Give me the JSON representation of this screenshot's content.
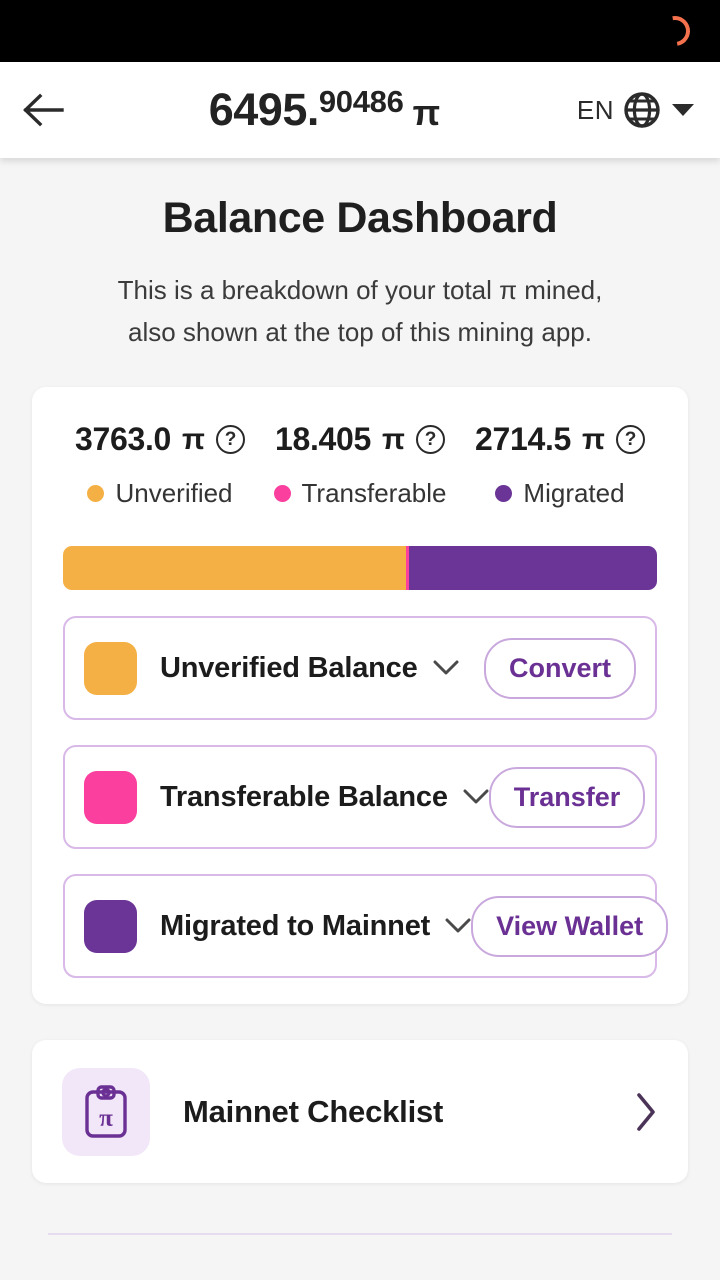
{
  "status_bar": {
    "spinner_icon": "loading-spinner-icon",
    "spinner_color": "#f4714e"
  },
  "header": {
    "back_icon": "back-arrow-icon",
    "balance_integer": "6495.",
    "balance_fraction": "90486",
    "pi_symbol": "π",
    "language_code": "EN",
    "globe_icon": "globe-icon",
    "caret_icon": "chevron-down-icon"
  },
  "page": {
    "title": "Balance Dashboard",
    "subtitle_line1": "This is a breakdown of your total π mined,",
    "subtitle_line2": "also shown at the top of this mining app."
  },
  "totals": [
    {
      "value": "3763.0",
      "pi": "π",
      "help_icon": "help-circle-icon",
      "legend": "Unverified",
      "color": "#f5b045"
    },
    {
      "value": "18.405",
      "pi": "π",
      "help_icon": "help-circle-icon",
      "legend": "Transferable",
      "color": "#fa3f9e"
    },
    {
      "value": "2714.5",
      "pi": "π",
      "help_icon": "help-circle-icon",
      "legend": "Migrated",
      "color": "#6b3597"
    }
  ],
  "chart_data": {
    "type": "bar",
    "orientation": "horizontal-stacked",
    "title": "Balance Dashboard",
    "categories": [
      "Unverified",
      "Transferable",
      "Migrated"
    ],
    "values": [
      3763.0,
      18.405,
      2714.5
    ],
    "units": "π",
    "total": 6495.90486,
    "colors": [
      "#f5b045",
      "#fa3f9e",
      "#6b3597"
    ],
    "percentages": [
      57.9,
      0.3,
      41.8
    ],
    "legend": "inline-above-bar",
    "grid": false
  },
  "rows": [
    {
      "label": "Unverified Balance",
      "color": "#f5b045",
      "chevron_icon": "chevron-down-icon",
      "button": "Convert"
    },
    {
      "label": "Transferable Balance",
      "color": "#fa3f9e",
      "chevron_icon": "chevron-down-icon",
      "button": "Transfer"
    },
    {
      "label": "Migrated to Mainnet",
      "color": "#6b3597",
      "chevron_icon": "chevron-down-icon",
      "button": "View Wallet"
    }
  ],
  "checklist": {
    "icon": "clipboard-pi-icon",
    "label": "Mainnet Checklist",
    "chevron_icon": "chevron-right-icon"
  },
  "theme": {
    "accent_purple": "#6a3094",
    "border_lavender": "#d8b9e8",
    "page_background": "#f5f5f6"
  }
}
